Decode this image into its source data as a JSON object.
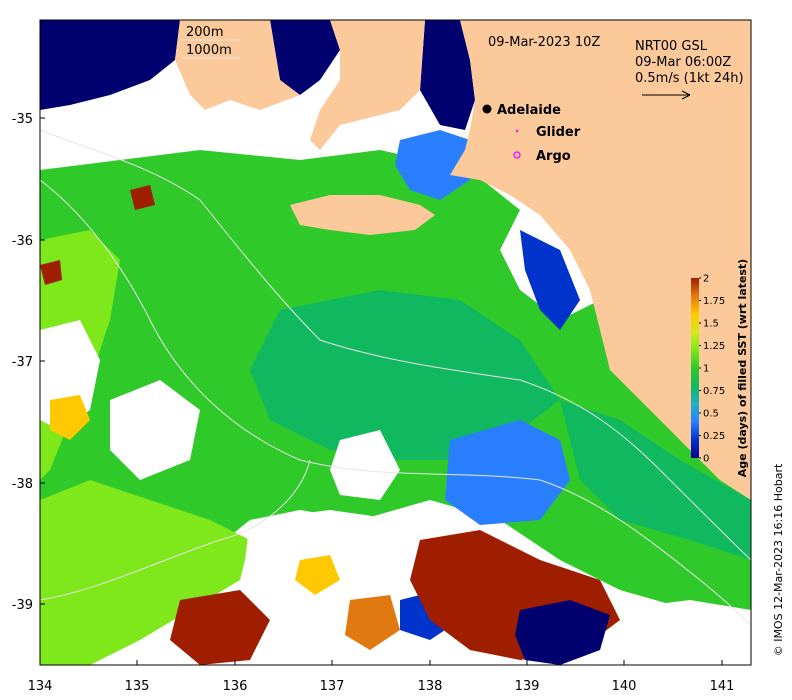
{
  "map": {
    "date_title": "09-Mar-2023 10Z",
    "isobath_labels": [
      "200m",
      "1000m"
    ],
    "current_info": {
      "line1": "NRT00 GSL",
      "line2": "09-Mar 06:00Z",
      "line3": "0.5m/s (1kt 24h)"
    },
    "legend": {
      "adelaide": "Adelaide",
      "glider": "Glider",
      "argo": "Argo"
    },
    "x_ticks": [
      "134",
      "135",
      "136",
      "137",
      "138",
      "139",
      "140",
      "141"
    ],
    "y_ticks": [
      "-35",
      "-36",
      "-37",
      "-38",
      "-39"
    ],
    "x_range": [
      134,
      141.3
    ],
    "y_range": [
      -39.5,
      -34.2
    ],
    "colorbar": {
      "title": "Age (days) of filled SST (wrt latest)",
      "ticks": [
        "2",
        "1.75",
        "1.5",
        "1.25",
        "1",
        "0.75",
        "0.5",
        "0.25",
        "0"
      ],
      "range": [
        0,
        2
      ],
      "colors": [
        "#00008b",
        "#0033cc",
        "#2a7fff",
        "#22b0c8",
        "#10b860",
        "#2fc92a",
        "#7ee81a",
        "#d6e81a",
        "#ffc800",
        "#e07a10",
        "#a01e00"
      ]
    },
    "credit": "© IMOS 12-Mar-2023 16:16 Hobart",
    "colors": {
      "land": "#fcc99b",
      "deep_water": "#00006e",
      "no_data": "#ffffff"
    }
  }
}
